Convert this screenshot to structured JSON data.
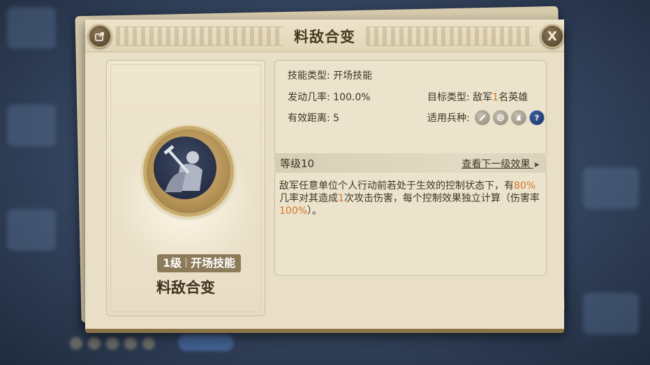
{
  "dialog": {
    "title": "料敌合变",
    "close_label": "X"
  },
  "skill": {
    "badge_level": "1级",
    "badge_type": "开场技能",
    "name": "料敌合变"
  },
  "info": {
    "skill_type_label": "技能类型:",
    "skill_type_value": "开场技能",
    "trigger_rate_label": "发动几率:",
    "trigger_rate_value": "100.0%",
    "range_label": "有效距离:",
    "range_value": "5",
    "target_type_label": "目标类型:",
    "target_prefix": "敌军",
    "target_count": "1",
    "target_suffix": "名英雄",
    "troop_type_label": "适用兵种:",
    "troop_icons": [
      "sword-icon",
      "shield-icon",
      "horse-icon",
      "question-icon"
    ],
    "troop_question": "?"
  },
  "level": {
    "label": "等级10",
    "next_link": "查看下一级效果",
    "next_arrow": "➤"
  },
  "description": {
    "part1": "敌军任意单位个人行动前若处于生效的控制状态下，有",
    "value1": "80%",
    "part2": "几率对其造成",
    "value2": "1",
    "part3": "次攻击伤害，每个控制效果独立计算（伤害率",
    "value3": "100%",
    "part4": "）。"
  },
  "colors": {
    "highlight": "#d4762b",
    "panel_bg": "#e9dfc7",
    "text": "#3f3526"
  }
}
